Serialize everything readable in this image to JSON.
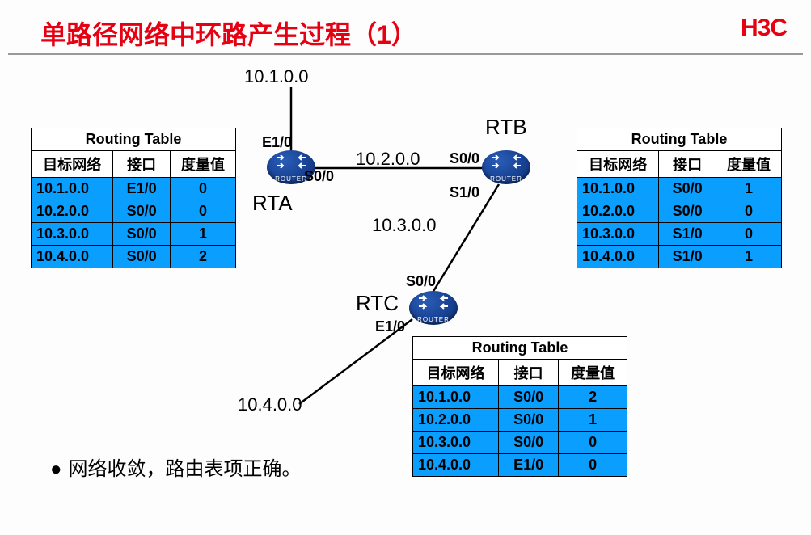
{
  "title": "单路径网络中环路产生过程（1）",
  "logo": "H3C",
  "networks": {
    "n1": "10.1.0.0",
    "n2": "10.2.0.0",
    "n3": "10.3.0.0",
    "n4": "10.4.0.0"
  },
  "routers": {
    "rta": {
      "name": "RTA",
      "if1": "E1/0",
      "if2": "S0/0"
    },
    "rtb": {
      "name": "RTB",
      "if1": "S0/0",
      "if2": "S1/0"
    },
    "rtc": {
      "name": "RTC",
      "if1": "S0/0",
      "if2": "E1/0"
    }
  },
  "router_text": "ROUTER",
  "table_title": "Routing Table",
  "headers": {
    "dest": "目标网络",
    "iface": "接口",
    "metric": "度量值"
  },
  "rta_routes": [
    {
      "dest": "10.1.0.0",
      "iface": "E1/0",
      "metric": "0"
    },
    {
      "dest": "10.2.0.0",
      "iface": "S0/0",
      "metric": "0"
    },
    {
      "dest": "10.3.0.0",
      "iface": "S0/0",
      "metric": "1"
    },
    {
      "dest": "10.4.0.0",
      "iface": "S0/0",
      "metric": "2"
    }
  ],
  "rtb_routes": [
    {
      "dest": "10.1.0.0",
      "iface": "S0/0",
      "metric": "1"
    },
    {
      "dest": "10.2.0.0",
      "iface": "S0/0",
      "metric": "0"
    },
    {
      "dest": "10.3.0.0",
      "iface": "S1/0",
      "metric": "0"
    },
    {
      "dest": "10.4.0.0",
      "iface": "S1/0",
      "metric": "1"
    }
  ],
  "rtc_routes": [
    {
      "dest": "10.1.0.0",
      "iface": "S0/0",
      "metric": "2"
    },
    {
      "dest": "10.2.0.0",
      "iface": "S0/0",
      "metric": "1"
    },
    {
      "dest": "10.3.0.0",
      "iface": "S0/0",
      "metric": "0"
    },
    {
      "dest": "10.4.0.0",
      "iface": "E1/0",
      "metric": "0"
    }
  ],
  "bullet": "网络收敛，路由表项正确。"
}
